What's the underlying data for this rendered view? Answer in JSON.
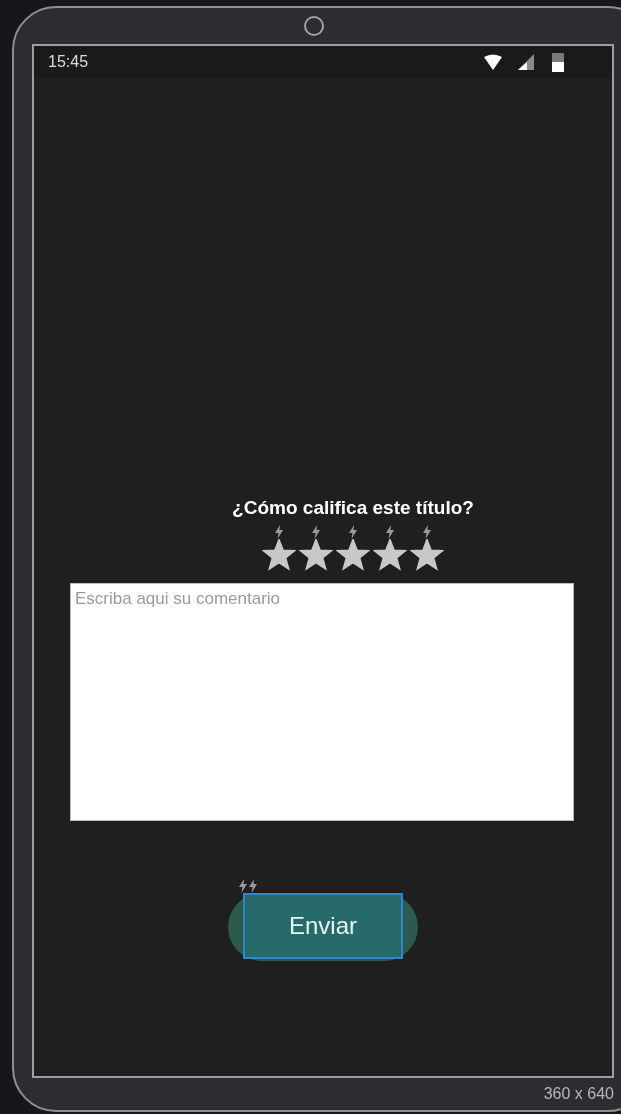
{
  "status_bar": {
    "time": "15:45"
  },
  "rating": {
    "question": "¿Cómo califica este título?",
    "stars": 5
  },
  "comment": {
    "placeholder": "Escriba aqui su comentario"
  },
  "submit_button": {
    "label": "Enviar"
  },
  "device_size": "360 x 640"
}
